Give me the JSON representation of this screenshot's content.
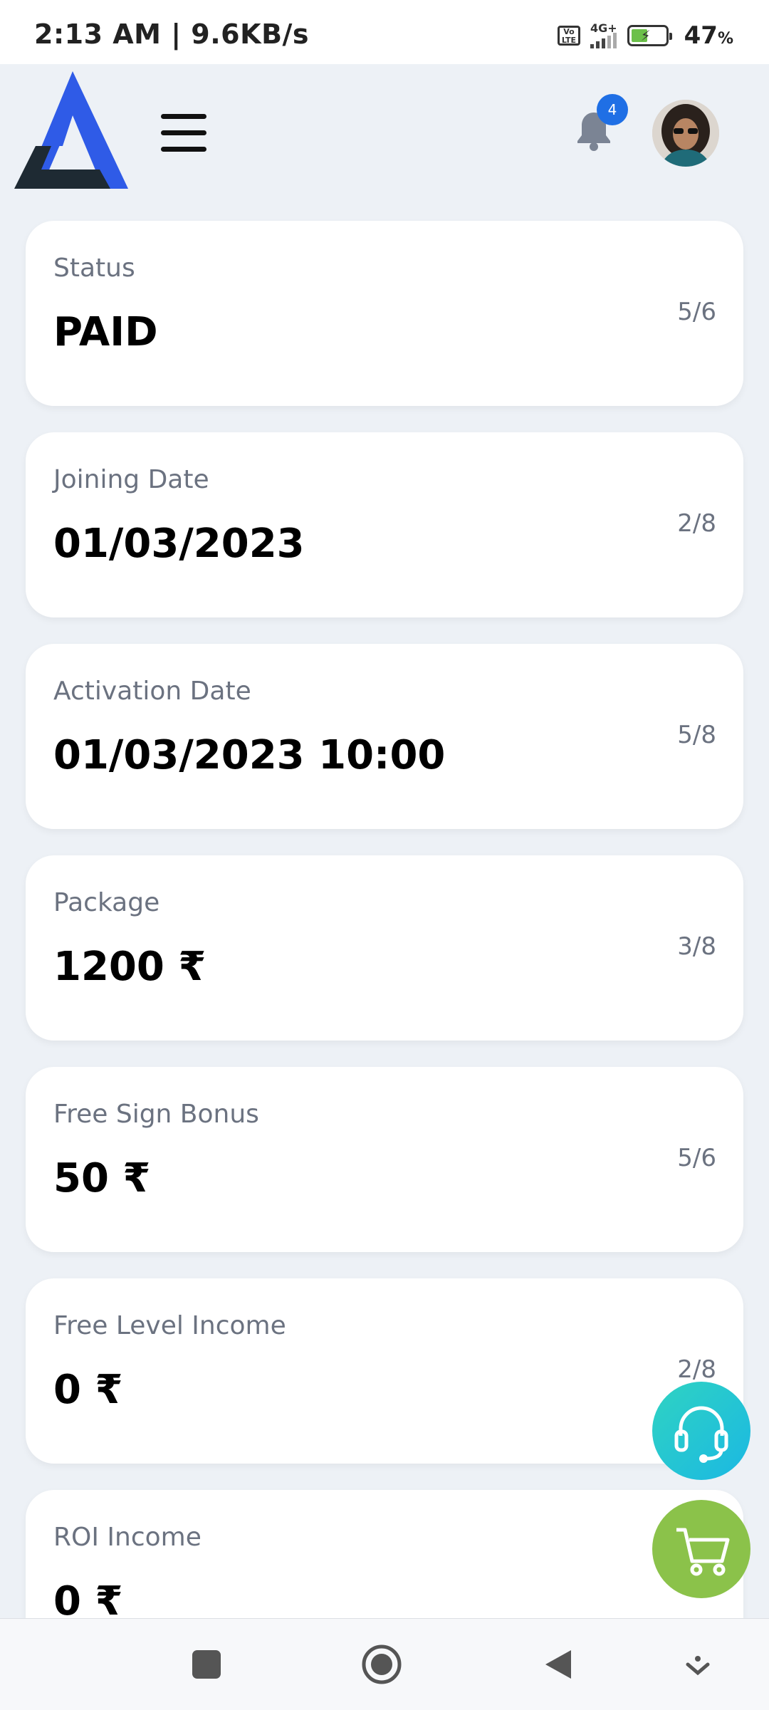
{
  "status_bar": {
    "time_speed": "2:13 AM | 9.6KB/s",
    "volte_label": "Vo LTE",
    "network": "4G+",
    "battery_percent": "47",
    "battery_unit": "%"
  },
  "header": {
    "notification_count": "4"
  },
  "cards": [
    {
      "label": "Status",
      "value": "PAID",
      "fraction": "5/6"
    },
    {
      "label": "Joining Date",
      "value": "01/03/2023",
      "fraction": "2/8"
    },
    {
      "label": "Activation Date",
      "value": "01/03/2023 10:00",
      "fraction": "5/8"
    },
    {
      "label": "Package",
      "value": "1200 ₹",
      "fraction": "3/8"
    },
    {
      "label": "Free Sign Bonus",
      "value": "50 ₹",
      "fraction": "5/6"
    },
    {
      "label": "Free Level Income",
      "value": "0 ₹",
      "fraction": "2/8"
    },
    {
      "label": "ROI Income",
      "value": "0 ₹",
      "fraction": ""
    }
  ],
  "colors": {
    "brand_blue": "#2f5be7",
    "badge_blue": "#1f6fe5",
    "support_teal": "#2fd3c2",
    "cart_green": "#8bc24a"
  }
}
